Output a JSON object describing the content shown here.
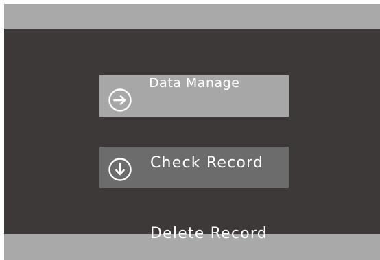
{
  "menu": {
    "items": [
      {
        "label": "Data Manage",
        "icon": "arrow-right-circle-icon",
        "state": "selected"
      },
      {
        "label": "Check Record",
        "icon": "arrow-down-circle-icon",
        "state": "highlighted"
      },
      {
        "label": "Delete Record",
        "state": "normal"
      }
    ]
  },
  "colors": {
    "background": "#3d3938",
    "bars": "#a9a9a9",
    "selected_item": "#a7a7a7",
    "highlighted_item": "#6c6c6c",
    "text": "#ffffff"
  }
}
